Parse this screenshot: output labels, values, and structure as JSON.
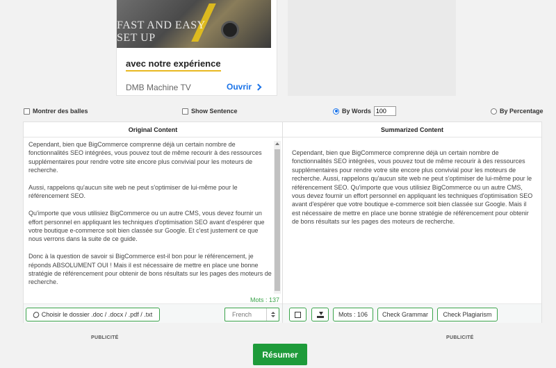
{
  "ad": {
    "image_text": "FAST AND EASY\nSET UP",
    "headline": "avec notre expérience",
    "brand": "DMB Machine TV",
    "open_label": "Ouvrir"
  },
  "options": {
    "show_bullets": "Montrer des balles",
    "show_sentence": "Show Sentence",
    "by_words": "By Words",
    "by_words_value": "100",
    "by_percentage": "By Percentage"
  },
  "original": {
    "title": "Original Content",
    "paragraphs": [
      "Cependant,  bien que BigCommerce comprenne déjà un certain nombre de fonctionnalités SEO intégrées, vous pouvez tout de même recourir à des ressources supplémentaires pour rendre votre site encore plus convivial pour les moteurs de recherche.",
      "Aussi, rappelons qu'aucun site web ne peut s'optimiser de lui-même pour le référencement SEO.",
      "Qu'importe que vous utilisiez BigCommerce ou un autre CMS, vous devez fournir un effort personnel en appliquant les techniques d'optimisation SEO avant d'espérer que votre boutique e-commerce soit bien classée sur Google. Et c'est justement ce que nous verrons dans la suite de ce guide.",
      "Donc à la question de savoir si BigCommerce est-il bon pour le référencement, je réponds ABSOLUMENT OUI ! Mais il est nécessaire de mettre en place une bonne stratégie de référencement pour obtenir de bons résultats sur les pages des moteurs de recherche."
    ],
    "word_count": "Mots : 137",
    "file_button": "Choisir le dossier .doc / .docx / .pdf / .txt",
    "language": "French"
  },
  "summary": {
    "title": "Summarized Content",
    "text": "Cependant, bien que BigCommerce comprenne déjà un certain nombre de fonctionnalités SEO intégrées, vous pouvez tout de même recourir à des ressources supplémentaires pour rendre votre site encore plus convivial pour les moteurs de recherche. Aussi, rappelons qu'aucun site web ne peut s'optimiser de lui-même pour le référencement SEO. Qu'importe que vous utilisiez BigCommerce ou un autre CMS, vous devez fournir un effort personnel en appliquant les techniques d'optimisation SEO avant d'espérer que votre boutique e-commerce soit bien classée sur Google. Mais il est nécessaire de mettre en place une bonne stratégie de référencement pour obtenir de bons résultats sur les pages des moteurs de recherche.",
    "word_count": "Mots : 106",
    "check_grammar": "Check Grammar",
    "check_plagiarism": "Check Plagiarism"
  },
  "footer": {
    "pub_left": "PUBLICITÉ",
    "pub_right": "PUBLICITÉ",
    "submit": "Résumer"
  },
  "colors": {
    "accent_green": "#1e9b3a",
    "link_blue": "#1a73e8",
    "headline_underline": "#e8b820"
  }
}
